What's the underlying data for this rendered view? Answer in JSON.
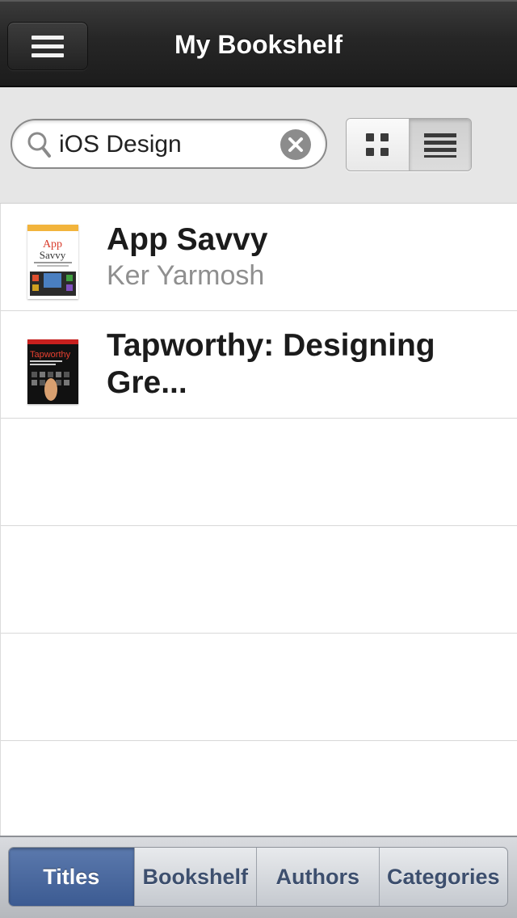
{
  "header": {
    "title": "My Bookshelf",
    "menu_icon": "hamburger-menu-icon"
  },
  "search": {
    "value": "iOS Design",
    "placeholder": "",
    "search_icon": "magnifier-icon",
    "clear_icon": "clear-x-icon"
  },
  "view_toggle": {
    "options": [
      "grid",
      "list"
    ],
    "selected": "list",
    "grid_icon": "grid-view-icon",
    "list_icon": "list-view-icon"
  },
  "books": [
    {
      "title": "App Savvy",
      "author": "Ker Yarmosh",
      "cover": {
        "heading": "App",
        "heading2": "Savvy"
      }
    },
    {
      "title": "Tapworthy: Designing Gre...",
      "author": "",
      "cover": {
        "heading": "Tapworthy"
      }
    }
  ],
  "tabs": [
    {
      "label": "Titles",
      "active": true
    },
    {
      "label": "Bookshelf",
      "active": false
    },
    {
      "label": "Authors",
      "active": false
    },
    {
      "label": "Categories",
      "active": false
    }
  ],
  "colors": {
    "nav_bg": "#262626",
    "active_tab": "#4a6aa0",
    "tab_text": "#3d4f6e",
    "author_text": "#8f8f8f"
  }
}
